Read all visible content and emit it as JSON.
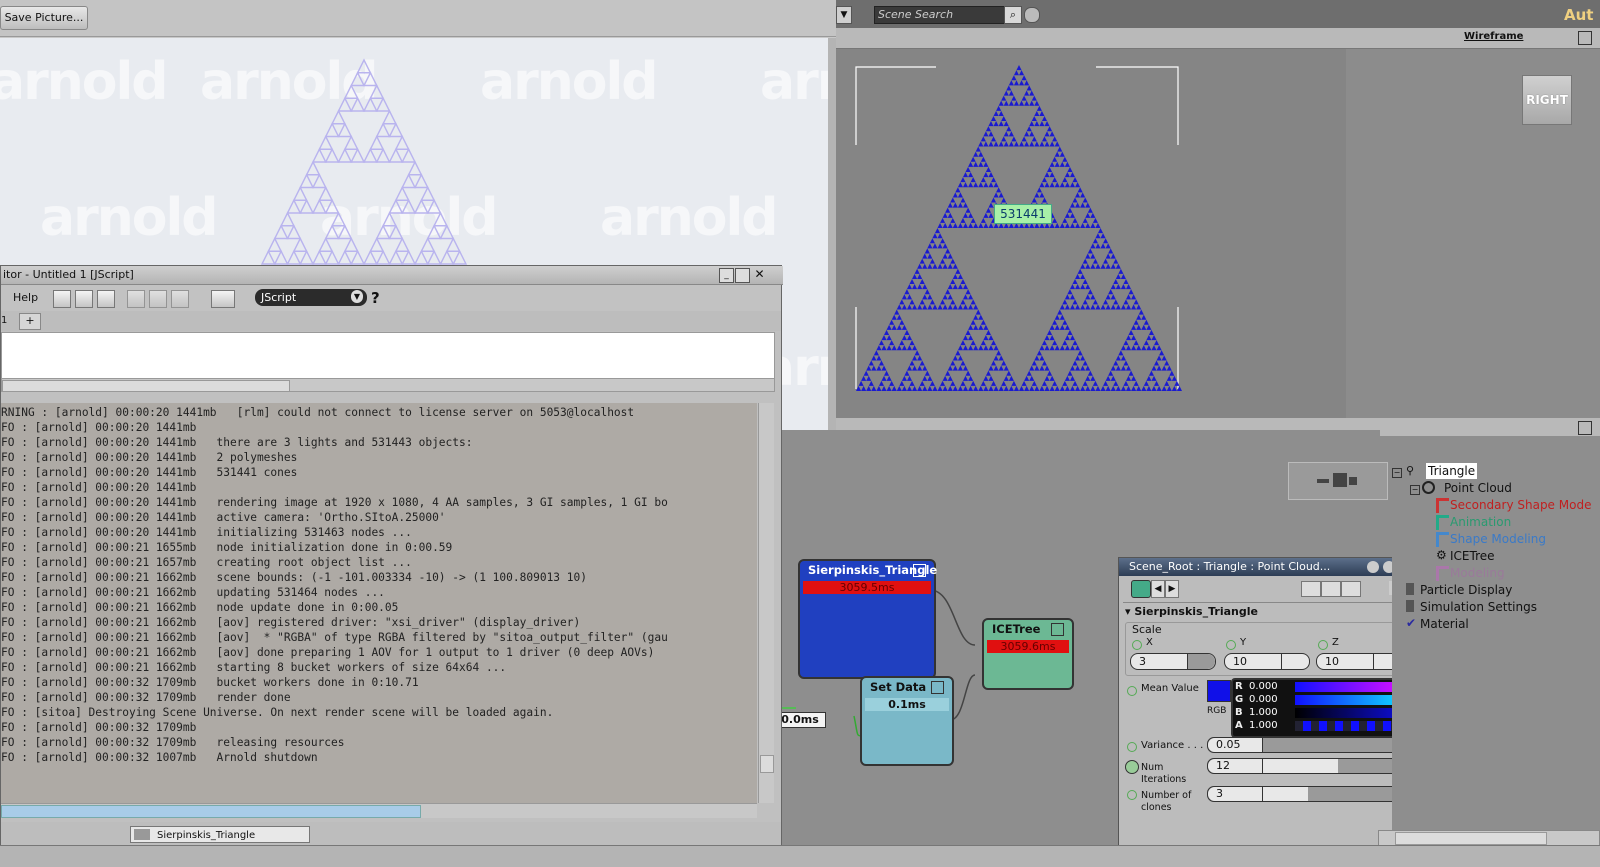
{
  "render_window": {
    "save_label": "Save Picture...",
    "watermark": "arnold"
  },
  "viewport": {
    "search_placeholder": "Scene Search",
    "mode": "Wireframe",
    "view_cube": "RIGHT",
    "point_count": "531441",
    "corner_text": "Aut"
  },
  "script_editor": {
    "title": "itor - Untitled 1  [JScript]",
    "menu_help": "Help",
    "language": "JScript",
    "tab": "1",
    "add_tab": "+",
    "status_item": "Sierpinskis_Triangle",
    "log": [
      "RNING : [arnold] 00:00:20 1441mb   [rlm] could not connect to license server on 5053@localhost",
      "FO : [arnold] 00:00:20 1441mb",
      "FO : [arnold] 00:00:20 1441mb   there are 3 lights and 531443 objects:",
      "FO : [arnold] 00:00:20 1441mb   2 polymeshes",
      "FO : [arnold] 00:00:20 1441mb   531441 cones",
      "FO : [arnold] 00:00:20 1441mb",
      "FO : [arnold] 00:00:20 1441mb   rendering image at 1920 x 1080, 4 AA samples, 3 GI samples, 1 GI bo",
      "FO : [arnold] 00:00:20 1441mb   active camera: 'Ortho.SItoA.25000'",
      "FO : [arnold] 00:00:20 1441mb   initializing 531463 nodes ...",
      "FO : [arnold] 00:00:21 1655mb   node initialization done in 0:00.59",
      "FO : [arnold] 00:00:21 1657mb   creating root object list ...",
      "FO : [arnold] 00:00:21 1662mb   scene bounds: (-1 -101.003334 -10) -> (1 100.809013 10)",
      "FO : [arnold] 00:00:21 1662mb   updating 531464 nodes ...",
      "FO : [arnold] 00:00:21 1662mb   node update done in 0:00.05",
      "FO : [arnold] 00:00:21 1662mb   [aov] registered driver: \"xsi_driver\" (display_driver)",
      "FO : [arnold] 00:00:21 1662mb   [aov]  * \"RGBA\" of type RGBA filtered by \"sitoa_output_filter\" (gau",
      "FO : [arnold] 00:00:21 1662mb   [aov] done preparing 1 AOV for 1 output to 1 driver (0 deep AOVs)",
      "FO : [arnold] 00:00:21 1662mb   starting 8 bucket workers of size 64x64 ...",
      "FO : [arnold] 00:00:32 1709mb   bucket workers done in 0:10.71",
      "FO : [arnold] 00:00:32 1709mb   render done",
      "FO : [sitoa] Destroying Scene Universe. On next render scene will be loaded again.",
      "FO : [arnold] 00:00:32 1709mb",
      "FO : [arnold] 00:00:32 1709mb   releasing resources",
      "FO : [arnold] 00:00:32 1007mb   Arnold shutdown"
    ]
  },
  "ice_tree": {
    "node_sierpinski": {
      "title": "Sierpinskis_Triangle",
      "time": "3059.5ms"
    },
    "node_icetree": {
      "title": "ICETree",
      "time": "3059.6ms"
    },
    "node_setdata": {
      "title": "Set Data",
      "time": "0.1ms"
    },
    "input_time": "0.0ms"
  },
  "ppg": {
    "title": "Scene_Root : Triangle : Point Cloud...",
    "section": "Sierpinskis_Triangle",
    "scale_label": "Scale",
    "x_label": "X",
    "x_value": "3",
    "y_label": "Y",
    "y_value": "10",
    "z_label": "Z",
    "z_value": "10",
    "mean_value_label": "Mean Value",
    "rgb_label": "RGB",
    "r_label": "R",
    "r_value": "0.000",
    "g_label": "G",
    "g_value": "0.000",
    "b_label": "B",
    "b_value": "1.000",
    "a_label": "A",
    "a_value": "1.000",
    "variance_label": "Variance . . . .",
    "variance_value": "0.05",
    "iterations_label": "Num\nIterations",
    "iterations_value": "12",
    "clones_label": "Number of\nclones",
    "clones_value": "3",
    "help": "?"
  },
  "explorer": {
    "items": [
      {
        "label": "Triangle"
      },
      {
        "label": "Point Cloud"
      },
      {
        "label": "Secondary Shape Mode"
      },
      {
        "label": "Animation"
      },
      {
        "label": "Shape Modeling"
      },
      {
        "label": "ICETree"
      },
      {
        "label": "Modeling"
      },
      {
        "label": "Particle Display"
      },
      {
        "label": "Simulation Settings"
      },
      {
        "label": "Material"
      }
    ]
  },
  "colors": {
    "fractal_blue": "#1a1ad0",
    "node_red": "#e01010",
    "node_green": "#6cb894",
    "node_teal": "#7ab8c8"
  }
}
